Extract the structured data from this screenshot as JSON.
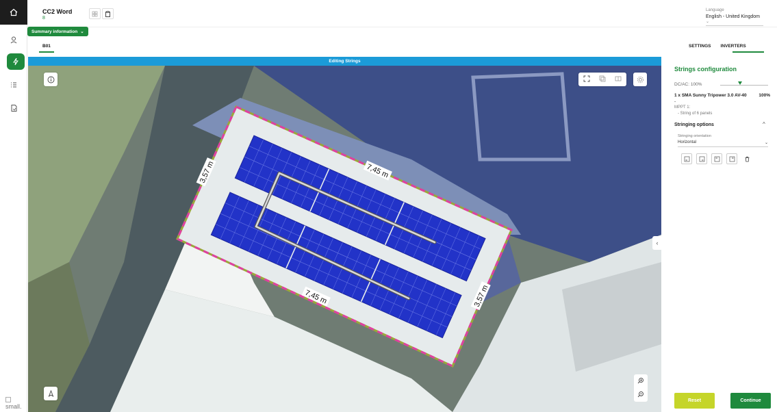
{
  "header": {
    "project_title": "CC2 Word",
    "project_sub": "8",
    "language_label": "Language",
    "language_value": "English - United Kingdom",
    "summary_label": "Summary information"
  },
  "tabs": {
    "building_tab": "B01",
    "settings_tab": "SETTINGS",
    "inverters_tab": "INVERTERS"
  },
  "map": {
    "banner": "Editing Strings",
    "dimensions": {
      "top_edge": "7,45 m",
      "bottom_edge": "7,45 m",
      "left_edge": "3,57 m",
      "right_edge": "3,57 m"
    }
  },
  "panel": {
    "title": "Strings configuration",
    "dcac_label": "DC/AC: 100%",
    "dcac_value": 1.0,
    "inverter_name": "1 x SMA Sunny Tripower 3.0 AV-40",
    "inverter_percent": "100%",
    "inverter_dash": "-",
    "mppt_label": "MPPT 1:",
    "mppt_string": "- String of 6 panels",
    "stringing_title": "Stringing options",
    "orientation_label": "Stringing orientation",
    "orientation_value": "Horizontal",
    "reset_label": "Reset",
    "continue_label": "Continue"
  },
  "rail": {
    "logo_text": "small."
  },
  "colors": {
    "accent_green": "#1f8a3d",
    "banner_blue": "#1b9bd8",
    "reset_lime": "#c5d52a",
    "panel_blue": "#2233c8",
    "roof_outline": "#e040a0"
  }
}
